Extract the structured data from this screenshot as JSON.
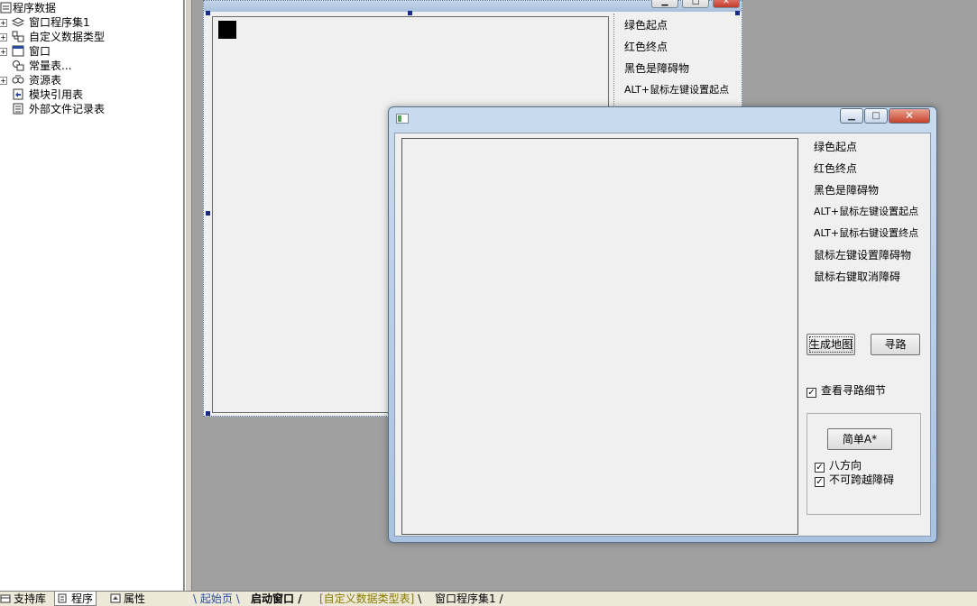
{
  "tree": {
    "items": [
      {
        "label": "程序数据",
        "icon": "data-icon"
      },
      {
        "label": "窗口程序集1",
        "icon": "layers-icon"
      },
      {
        "label": "自定义数据类型",
        "icon": "type-icon"
      },
      {
        "label": "窗口",
        "icon": "window-icon"
      },
      {
        "label": "常量表...",
        "icon": "constants-icon"
      },
      {
        "label": "资源表",
        "icon": "resource-icon"
      },
      {
        "label": "模块引用表",
        "icon": "module-icon"
      },
      {
        "label": "外部文件记录表",
        "icon": "file-icon"
      }
    ]
  },
  "bottom_tabs": [
    {
      "label": "支持库",
      "icon": "library-icon"
    },
    {
      "label": "程序",
      "icon": "program-icon"
    },
    {
      "label": "属性",
      "icon": "properties-icon"
    }
  ],
  "doc_tabs": [
    {
      "label": "起始页",
      "color": "#2a4ca0"
    },
    {
      "label": "启动窗口",
      "color": "#000000"
    },
    {
      "label": "[自定义数据类型表]",
      "color": "#8a7a00"
    },
    {
      "label": "窗口程序集1",
      "color": "#000000"
    }
  ],
  "designer": {
    "labels": [
      "绿色起点",
      "红色终点",
      "黑色是障碍物",
      "ALT+鼠标左键设置起点"
    ],
    "buttons": {
      "minimize": "▁",
      "maximize": "□",
      "close": "✕"
    }
  },
  "window": {
    "buttons": {
      "minimize": "▁",
      "maximize": "□",
      "close": "✕"
    },
    "info_labels": [
      "绿色起点",
      "红色终点",
      "黑色是障碍物",
      "ALT+鼠标左键设置起点",
      "ALT+鼠标右键设置终点",
      "鼠标左键设置障碍物",
      "鼠标右键取消障碍"
    ],
    "generate_map_label": "生成地图",
    "find_path_label": "寻路",
    "show_details": {
      "label": "查看寻路细节",
      "checked": true
    },
    "algorithm_button_label": "简单A*",
    "eight_directions": {
      "label": "八方向",
      "checked": true
    },
    "no_cross_obstacles": {
      "label": "不可跨越障碍",
      "checked": true
    },
    "check_mark": "✓"
  }
}
